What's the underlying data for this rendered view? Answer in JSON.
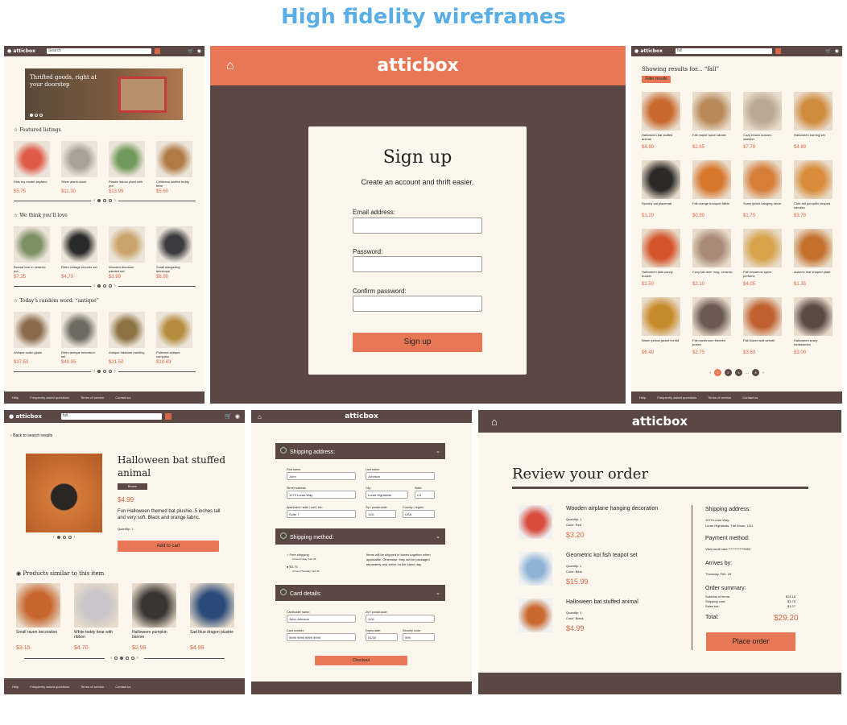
{
  "title": "High fidelity wireframes",
  "colors": {
    "accent": "#d86747",
    "header": "#5b4744",
    "bg": "#fdf6ec",
    "title": "#5aaee6"
  },
  "brand": "atticbox",
  "home": {
    "search": "Search",
    "hero_line1": "Thrifted goods, right at",
    "hero_line2": "your doorstep",
    "sections": [
      {
        "title": "Featured listings",
        "icon": "star-icon",
        "items": [
          {
            "name": "Kids toy model airplane",
            "price": "$5.75",
            "color": "#e05a4a"
          },
          {
            "name": "Silver alarm clock",
            "price": "$11.30",
            "color": "#a9a197"
          },
          {
            "name": "Plastic indoor plant with pot",
            "price": "$13.99",
            "color": "#6f9a5b"
          },
          {
            "name": "Childrens stuffed teddy bear",
            "price": "$5.60",
            "color": "#b07a45"
          }
        ]
      },
      {
        "title": "We think you'll love",
        "icon": "heart-icon",
        "items": [
          {
            "name": "Bonsai tree in ceramic pot",
            "price": "$7.25",
            "color": "#7b8f62"
          },
          {
            "name": "Retro vintage records set",
            "price": "$4.70",
            "color": "#2a2a2a"
          },
          {
            "name": "Wooden dinosaur painted set",
            "price": "$3.99",
            "color": "#c9a36b"
          },
          {
            "name": "Small stargazing telescope",
            "price": "$8.90",
            "color": "#3c3c40"
          }
        ]
      },
      {
        "title": "Today's random word: “antique”",
        "icon": "clock-icon",
        "items": [
          {
            "name": "Antique rustic globe",
            "price": "$37.50",
            "color": "#8a6a4a"
          },
          {
            "name": "Retro antique television set",
            "price": "$49.95",
            "color": "#6d6a62"
          },
          {
            "name": "Antique lakeside painting",
            "price": "$21.50",
            "color": "#8d7344"
          },
          {
            "name": "Polished antique compass",
            "price": "$19.49",
            "color": "#b58c3e"
          }
        ]
      }
    ],
    "footer": [
      "Help",
      "Frequently asked questions",
      "Terms of service",
      "Contact us"
    ]
  },
  "signup": {
    "title": "Sign up",
    "subtitle": "Create an account and thrift easier.",
    "email_label": "Email address:",
    "password_label": "Password:",
    "confirm_label": "Confirm password:",
    "button": "Sign up"
  },
  "results": {
    "search": "fall",
    "heading": "Showing results for... “fall”",
    "filter": "Filter results",
    "items": [
      {
        "name": "Halloween bat stuffed animal",
        "price": "$4.99",
        "color": "#c9692f"
      },
      {
        "name": "Fall maple spice candle",
        "price": "$2.65",
        "color": "#b88a5a"
      },
      {
        "name": "Cozy brown autumn sweater",
        "price": "$7.79",
        "color": "#b9a894"
      },
      {
        "name": "Halloween earring set",
        "price": "$4.89",
        "color": "#d08a3c"
      },
      {
        "name": "Spooky cat placemat",
        "price": "$1.29",
        "color": "#2c2a28"
      },
      {
        "name": "Fall orange bouquet fillers",
        "price": "$0.99",
        "color": "#d7772c"
      },
      {
        "name": "Scary ghost hanging decor",
        "price": "$1.70",
        "color": "#d67d38"
      },
      {
        "name": "Cute fall pumpkin shaped candles",
        "price": "$3.78",
        "color": "#d98c3a"
      },
      {
        "name": "Halloween kids candy bucket",
        "price": "$2.50",
        "color": "#d4542a"
      },
      {
        "name": "Cozy fall deer mug, ceramic",
        "price": "$2.10",
        "color": "#a88a78"
      },
      {
        "name": "Fall cinnamon spice perfume",
        "price": "$4.05",
        "color": "#d6a24a"
      },
      {
        "name": "Autumn leaf shaped plate",
        "price": "$1.35",
        "color": "#c4702c"
      },
      {
        "name": "Warm yellow jacket for fall",
        "price": "$6.49",
        "color": "#c78a2a"
      },
      {
        "name": "Fall mushroom themed poster",
        "price": "$2.75",
        "color": "#6b5a52"
      },
      {
        "name": "Fall flower wall wreath",
        "price": "$3.60",
        "color": "#c0612f"
      },
      {
        "name": "Halloween scary tombstones",
        "price": "$3.00",
        "color": "#5a4a44"
      }
    ],
    "pages": [
      "1",
      "2",
      "3",
      "...",
      "8"
    ],
    "footer": [
      "Help",
      "Frequently asked questions",
      "Terms of service",
      "Contact us"
    ]
  },
  "product": {
    "search": "fall",
    "back": "Back to search results",
    "title": "Halloween bat stuffed animal",
    "badge": "Brown",
    "price": "$4.99",
    "desc": "Fun Halloween themed bat plushie. 5 inches tall and very soft. Black and orange fabric.",
    "qty": "Quantity: 1",
    "add": "Add to cart",
    "similar": "Products similar to this item",
    "items": [
      {
        "name": "Small raven decoration",
        "price": "$3.15",
        "color": "#c7652e"
      },
      {
        "name": "White teddy bear with ribbon",
        "price": "$4.70",
        "color": "#c7c5c8"
      },
      {
        "name": "Halloween pumpkin banner",
        "price": "$2.99",
        "color": "#3a3432"
      },
      {
        "name": "Sad blue dragon plushie",
        "price": "$4.99",
        "color": "#2b4c7a"
      }
    ],
    "footer": [
      "Help",
      "Frequently asked questions",
      "Terms of service",
      "Contact us"
    ]
  },
  "checkout": {
    "ship_title": "Shipping address:",
    "first_label": "First name:",
    "first": "John",
    "last_label": "Last name:",
    "last": "Johnson",
    "street_label": "Street address:",
    "street": "1273 Lunar Way",
    "city_label": "City:",
    "city": "Lunar Highlands",
    "state_label": "State:",
    "state": "LU",
    "apt_label": "Apartment / suite / unit / etc:",
    "apt": "Suite 7",
    "zip_label": "Zip / postal code:",
    "zip": "1111",
    "country_label": "Country / region:",
    "country": "USA",
    "method_title": "Shipping method:",
    "free": "Free shipping",
    "free_sub": "Arrives Friday, Feb 28",
    "paid": "$3.75",
    "paid_sub": "Arrives Thursday, Feb 29",
    "note": "Items will be shipped in boxes together when applicable. Otherwise, they will be packaged separately and arrive on the same day.",
    "card_title": "Card details:",
    "holder_label": "Cardholder name:",
    "holder": "John Johnson",
    "czip_label": "Zip / postal code:",
    "czip": "1111",
    "num_label": "Card number:",
    "num": "9999 9999 9999 9999",
    "exp_label": "Expiry date:",
    "exp": "01/30",
    "sec_label": "Security code:",
    "sec": "999",
    "button": "Checkout"
  },
  "review": {
    "title": "Review your order",
    "items": [
      {
        "name": "Wooden airplane hanging decoration",
        "qty": "Quantity: 1",
        "color_text": "Color: Red",
        "price": "$3.20",
        "color": "#d94b3c"
      },
      {
        "name": "Geometric koi fish teapot set",
        "qty": "Quantity: 1",
        "color_text": "Color: Blue",
        "price": "$15.99",
        "color": "#8fb3d6"
      },
      {
        "name": "Halloween bat stuffed animal",
        "qty": "Quantity: 1",
        "color_text": "Color: Black",
        "price": "$4.99",
        "color": "#c9692f"
      }
    ],
    "ship_label": "Shipping address:",
    "ship_line1": "1273 Lunar Way,",
    "ship_line2": "Lunar Highlands, The Moon, 1111",
    "pay_label": "Payment method:",
    "pay": "Visa credit card ************9999",
    "arrive_label": "Arrives by:",
    "arrive": "Thursday, Feb. 29",
    "summary_label": "Order summary:",
    "sub_label": "Subtotal of items:",
    "sub": "$24.18",
    "shipc_label": "Shipping cost:",
    "shipc": "$3.75",
    "tax_label": "Sales tax:",
    "tax": "$1.27",
    "total_label": "Total:",
    "total": "$29.20",
    "button": "Place order"
  }
}
